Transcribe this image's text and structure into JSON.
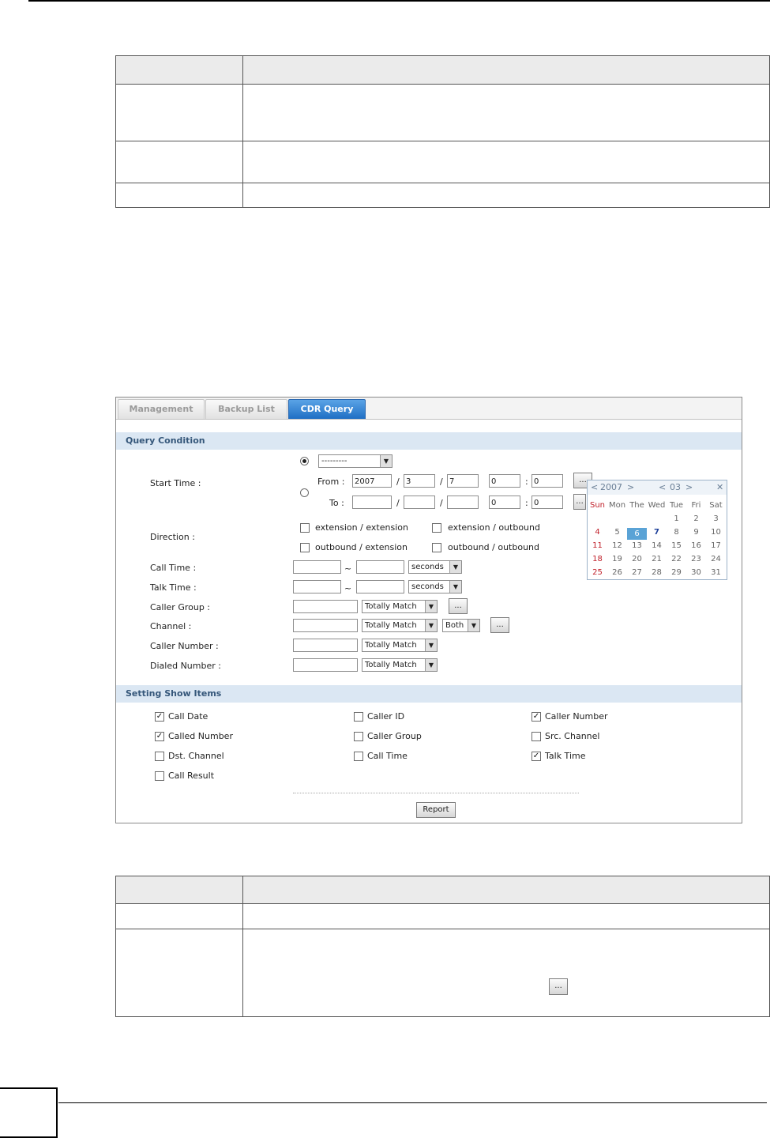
{
  "tabs": [
    "Management",
    "Backup List",
    "CDR Query"
  ],
  "sections": {
    "query": "Query Condition",
    "show": "Setting Show Items"
  },
  "labels": {
    "start_time": "Start Time :",
    "from": "From :",
    "to": "To :",
    "direction": "Direction :",
    "call_time": "Call Time :",
    "talk_time": "Talk Time :",
    "caller_group": "Caller Group :",
    "channel": "Channel :",
    "caller_number": "Caller Number :",
    "dialed_number": "Dialed Number :"
  },
  "start_time": {
    "preset_value": "---------",
    "from": {
      "year": "2007",
      "month": "3",
      "day": "7",
      "hour": "0",
      "minute": "0"
    },
    "to": {
      "year": "",
      "month": "",
      "day": "",
      "hour": "0",
      "minute": "0"
    },
    "slash": "/",
    "colon": ":",
    "browse": "..."
  },
  "direction_options": [
    "extension / extension",
    "extension / outbound",
    "outbound / extension",
    "outbound / outbound"
  ],
  "range_sep": "~",
  "unit": "seconds",
  "match": "Totally Match",
  "both": "Both",
  "browse": "...",
  "show_items": [
    {
      "label": "Call Date",
      "checked": true
    },
    {
      "label": "Caller ID",
      "checked": false
    },
    {
      "label": "Caller Number",
      "checked": true
    },
    {
      "label": "Called Number",
      "checked": true
    },
    {
      "label": "Caller Group",
      "checked": false
    },
    {
      "label": "Src. Channel",
      "checked": false
    },
    {
      "label": "Dst. Channel",
      "checked": false
    },
    {
      "label": "Call Time",
      "checked": false
    },
    {
      "label": "Talk Time",
      "checked": true
    },
    {
      "label": "Call Result",
      "checked": false
    }
  ],
  "check_mark": "✓",
  "report_button": "Report",
  "calendar": {
    "year": "2007",
    "month": "03",
    "prev": "<",
    "next": ">",
    "close": "✕",
    "weekdays": [
      "Sun",
      "Mon",
      "The",
      "Wed",
      "Tue",
      "Fri",
      "Sat"
    ],
    "weeks": [
      [
        "",
        "",
        "",
        "",
        "1",
        "2",
        "3"
      ],
      [
        "4",
        "5",
        "6",
        "7",
        "8",
        "9",
        "10"
      ],
      [
        "11",
        "12",
        "13",
        "14",
        "15",
        "16",
        "17"
      ],
      [
        "18",
        "19",
        "20",
        "21",
        "22",
        "23",
        "24"
      ],
      [
        "25",
        "26",
        "27",
        "28",
        "29",
        "30",
        "31"
      ]
    ],
    "selected_day": "6",
    "today": "7"
  },
  "doc_button": "..."
}
